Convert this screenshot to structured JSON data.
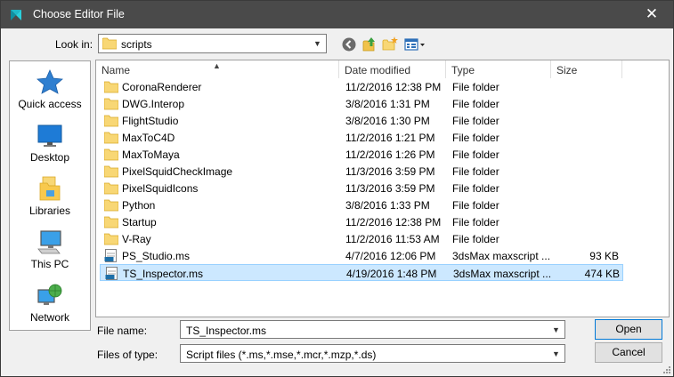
{
  "window": {
    "title": "Choose Editor File",
    "close_glyph": "✕"
  },
  "toolbar": {
    "look_in_label": "Look in:",
    "look_in_value": "scripts",
    "buttons": [
      "back-icon",
      "up-folder-icon",
      "new-folder-icon",
      "view-menu-icon"
    ]
  },
  "places": [
    {
      "label": "Quick access",
      "icon": "star-icon"
    },
    {
      "label": "Desktop",
      "icon": "desktop-icon"
    },
    {
      "label": "Libraries",
      "icon": "libraries-icon"
    },
    {
      "label": "This PC",
      "icon": "computer-icon"
    },
    {
      "label": "Network",
      "icon": "network-icon"
    }
  ],
  "columns": {
    "name": "Name",
    "date": "Date modified",
    "type": "Type",
    "size": "Size"
  },
  "files": [
    {
      "name": "CoronaRenderer",
      "date": "11/2/2016 12:38 PM",
      "type": "File folder",
      "size": "",
      "kind": "folder"
    },
    {
      "name": "DWG.Interop",
      "date": "3/8/2016 1:31 PM",
      "type": "File folder",
      "size": "",
      "kind": "folder"
    },
    {
      "name": "FlightStudio",
      "date": "3/8/2016 1:30 PM",
      "type": "File folder",
      "size": "",
      "kind": "folder"
    },
    {
      "name": "MaxToC4D",
      "date": "11/2/2016 1:21 PM",
      "type": "File folder",
      "size": "",
      "kind": "folder"
    },
    {
      "name": "MaxToMaya",
      "date": "11/2/2016 1:26 PM",
      "type": "File folder",
      "size": "",
      "kind": "folder"
    },
    {
      "name": "PixelSquidCheckImage",
      "date": "11/3/2016 3:59 PM",
      "type": "File folder",
      "size": "",
      "kind": "folder"
    },
    {
      "name": "PixelSquidIcons",
      "date": "11/3/2016 3:59 PM",
      "type": "File folder",
      "size": "",
      "kind": "folder"
    },
    {
      "name": "Python",
      "date": "3/8/2016 1:33 PM",
      "type": "File folder",
      "size": "",
      "kind": "folder"
    },
    {
      "name": "Startup",
      "date": "11/2/2016 12:38 PM",
      "type": "File folder",
      "size": "",
      "kind": "folder"
    },
    {
      "name": "V-Ray",
      "date": "11/2/2016 11:53 AM",
      "type": "File folder",
      "size": "",
      "kind": "folder"
    },
    {
      "name": "PS_Studio.ms",
      "date": "4/7/2016 12:06 PM",
      "type": "3dsMax maxscript ...",
      "size": "93 KB",
      "kind": "script"
    },
    {
      "name": "TS_Inspector.ms",
      "date": "4/19/2016 1:48 PM",
      "type": "3dsMax maxscript ...",
      "size": "474 KB",
      "kind": "script",
      "selected": true
    }
  ],
  "footer": {
    "file_name_label": "File name:",
    "file_name_value": "TS_Inspector.ms",
    "file_type_label": "Files of type:",
    "file_type_value": "Script files (*.ms,*.mse,*.mcr,*.mzp,*.ds)",
    "open_label": "Open",
    "cancel_label": "Cancel"
  },
  "colors": {
    "titlebar": "#4a4a4a",
    "folder": "#f8d775",
    "selection": "#cce8ff",
    "accent": "#0078d7"
  }
}
